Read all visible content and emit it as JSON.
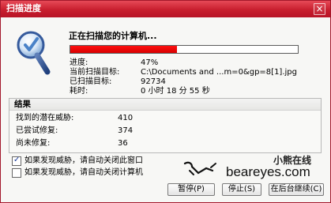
{
  "window": {
    "title": "扫描进度",
    "close_label": "×"
  },
  "scan": {
    "heading": "正在扫描您的计算机...",
    "progress_fraction": 0.47,
    "progress_label": "进度:",
    "progress_value": "47%",
    "current_target_label": "当前扫描目标:",
    "current_target_value": "C:\\Documents and ...m=0&gp=8[1].jpg",
    "scanned_label": "已扫描目标:",
    "scanned_value": "92734",
    "elapsed_label": "耗时:",
    "elapsed_value": "0 小时  18 分  55 秒"
  },
  "results": {
    "title": "结果",
    "rows": [
      {
        "label": "找到的潜在威胁:",
        "value": "410"
      },
      {
        "label": "已尝试修复:",
        "value": "374"
      },
      {
        "label": "尚未修复:",
        "value": "36"
      }
    ]
  },
  "options": [
    {
      "label": "如果发现威胁，请自动关闭此窗口",
      "checked": true
    },
    {
      "label": "如果发现威胁，请自动关闭计算机",
      "checked": false
    }
  ],
  "buttons": {
    "pause": "暂停(P)",
    "stop": "停止(S)",
    "background": "在后台继续(C)"
  },
  "watermark": {
    "chinese": "小熊在线",
    "url": "beareyes.com"
  },
  "colors": {
    "title_bar": "#c81e2e",
    "progress_fill": "#e00000",
    "window_border": "#a3182b"
  }
}
